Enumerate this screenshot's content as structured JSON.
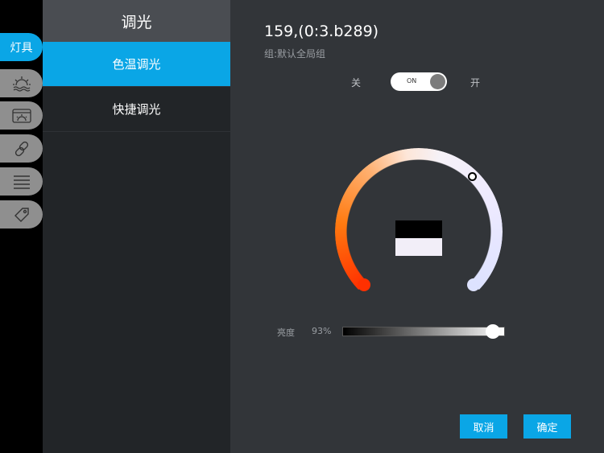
{
  "rail": {
    "tabs": [
      {
        "label": "灯具",
        "icon": "lamp"
      },
      {
        "icon": "sunrise-icon"
      },
      {
        "icon": "scene-icon"
      },
      {
        "icon": "link-icon"
      },
      {
        "icon": "list-icon"
      },
      {
        "icon": "tag-icon"
      }
    ]
  },
  "menu": {
    "title": "调光",
    "items": [
      "色温调光",
      "快捷调光"
    ]
  },
  "device": {
    "title": "159,(0:3.b289)",
    "group": "组:默认全局组"
  },
  "power": {
    "off_label": "关",
    "on_label": "开",
    "toggle_text": "ON",
    "state": true
  },
  "color_temp": {
    "position_fraction": 0.62
  },
  "brightness": {
    "label": "亮度",
    "value_text": "93%",
    "value": 93
  },
  "buttons": {
    "cancel": "取消",
    "confirm": "确定"
  },
  "colors": {
    "accent": "#0aa6e6"
  }
}
